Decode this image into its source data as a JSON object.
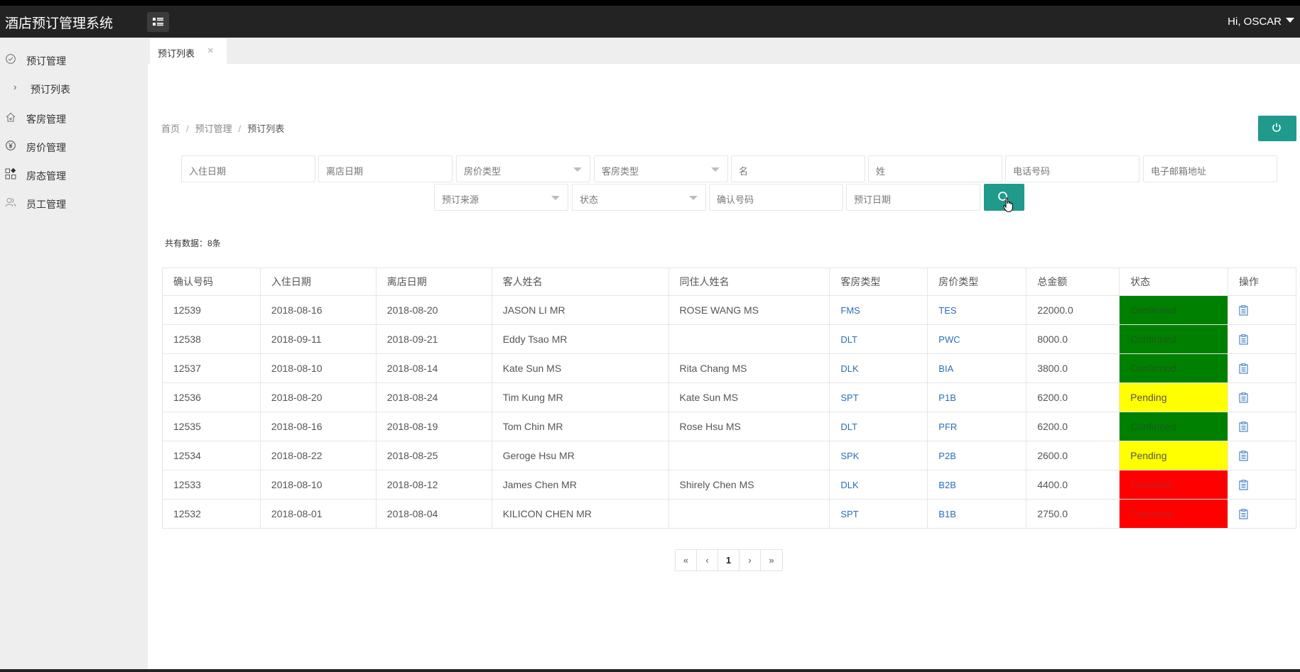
{
  "app": {
    "title": "酒店预订管理系统",
    "user_greeting": "Hi, OSCAR"
  },
  "sidebar": {
    "items": [
      {
        "label": "预订管理",
        "icon": "clock-check-icon"
      },
      {
        "label": "预订列表",
        "icon": "chevron-right-icon"
      },
      {
        "label": "客房管理",
        "icon": "home-icon"
      },
      {
        "label": "房价管理",
        "icon": "yen-icon"
      },
      {
        "label": "房态管理",
        "icon": "grid-icon"
      },
      {
        "label": "员工管理",
        "icon": "users-icon"
      }
    ]
  },
  "tabs": [
    {
      "label": "预订列表",
      "close": "×"
    }
  ],
  "breadcrumb": {
    "home": "首页",
    "section": "预订管理",
    "current": "预订列表",
    "sep": "/"
  },
  "filters": {
    "checkin_date": "入住日期",
    "checkout_date": "离店日期",
    "rate_type": "房价类型",
    "room_type": "客房类型",
    "first_name": "名",
    "last_name": "姓",
    "phone": "电话号码",
    "email": "电子邮箱地址",
    "source": "预订来源",
    "status": "状态",
    "confirmation_no": "确认号码",
    "booking_date": "预订日期"
  },
  "summary": {
    "count_text": "共有数据：8条"
  },
  "table": {
    "headers": [
      "确认号码",
      "入住日期",
      "离店日期",
      "客人姓名",
      "同住人姓名",
      "客房类型",
      "房价类型",
      "总金额",
      "状态",
      "操作"
    ],
    "rows": [
      {
        "conf": "12539",
        "checkin": "2018-08-16",
        "checkout": "2018-08-20",
        "guest": "JASON LI MR",
        "co_guest": "ROSE WANG MS",
        "room": "FMS",
        "rate": "TES",
        "amount": "22000.0",
        "status": "Confirmed"
      },
      {
        "conf": "12538",
        "checkin": "2018-09-11",
        "checkout": "2018-09-21",
        "guest": "Eddy Tsao MR",
        "co_guest": "",
        "room": "DLT",
        "rate": "PWC",
        "amount": "8000.0",
        "status": "Confirmed"
      },
      {
        "conf": "12537",
        "checkin": "2018-08-10",
        "checkout": "2018-08-14",
        "guest": "Kate Sun MS",
        "co_guest": "Rita Chang MS",
        "room": "DLK",
        "rate": "BIA",
        "amount": "3800.0",
        "status": "Confirmed"
      },
      {
        "conf": "12536",
        "checkin": "2018-08-20",
        "checkout": "2018-08-24",
        "guest": "Tim Kung MR",
        "co_guest": "Kate Sun MS",
        "room": "SPT",
        "rate": "P1B",
        "amount": "6200.0",
        "status": "Pending"
      },
      {
        "conf": "12535",
        "checkin": "2018-08-16",
        "checkout": "2018-08-19",
        "guest": "Tom Chin MR",
        "co_guest": "Rose Hsu MS",
        "room": "DLT",
        "rate": "PFR",
        "amount": "6200.0",
        "status": "Confirmed"
      },
      {
        "conf": "12534",
        "checkin": "2018-08-22",
        "checkout": "2018-08-25",
        "guest": "Geroge Hsu MR",
        "co_guest": "",
        "room": "SPK",
        "rate": "P2B",
        "amount": "2600.0",
        "status": "Pending"
      },
      {
        "conf": "12533",
        "checkin": "2018-08-10",
        "checkout": "2018-08-12",
        "guest": "James Chen MR",
        "co_guest": "Shirely Chen MS",
        "room": "DLK",
        "rate": "B2B",
        "amount": "4400.0",
        "status": "Canceled"
      },
      {
        "conf": "12532",
        "checkin": "2018-08-01",
        "checkout": "2018-08-04",
        "guest": "KILICON CHEN MR",
        "co_guest": "",
        "room": "SPT",
        "rate": "B1B",
        "amount": "2750.0",
        "status": "Canceled"
      }
    ]
  },
  "pagination": {
    "first": "«",
    "prev": "‹",
    "current": "1",
    "next": "›",
    "last": "»"
  },
  "colors": {
    "accent": "#1f9a8b",
    "confirmed": "#008000",
    "pending": "#ffff00",
    "canceled": "#ff0000",
    "link": "#2a6fb8"
  }
}
